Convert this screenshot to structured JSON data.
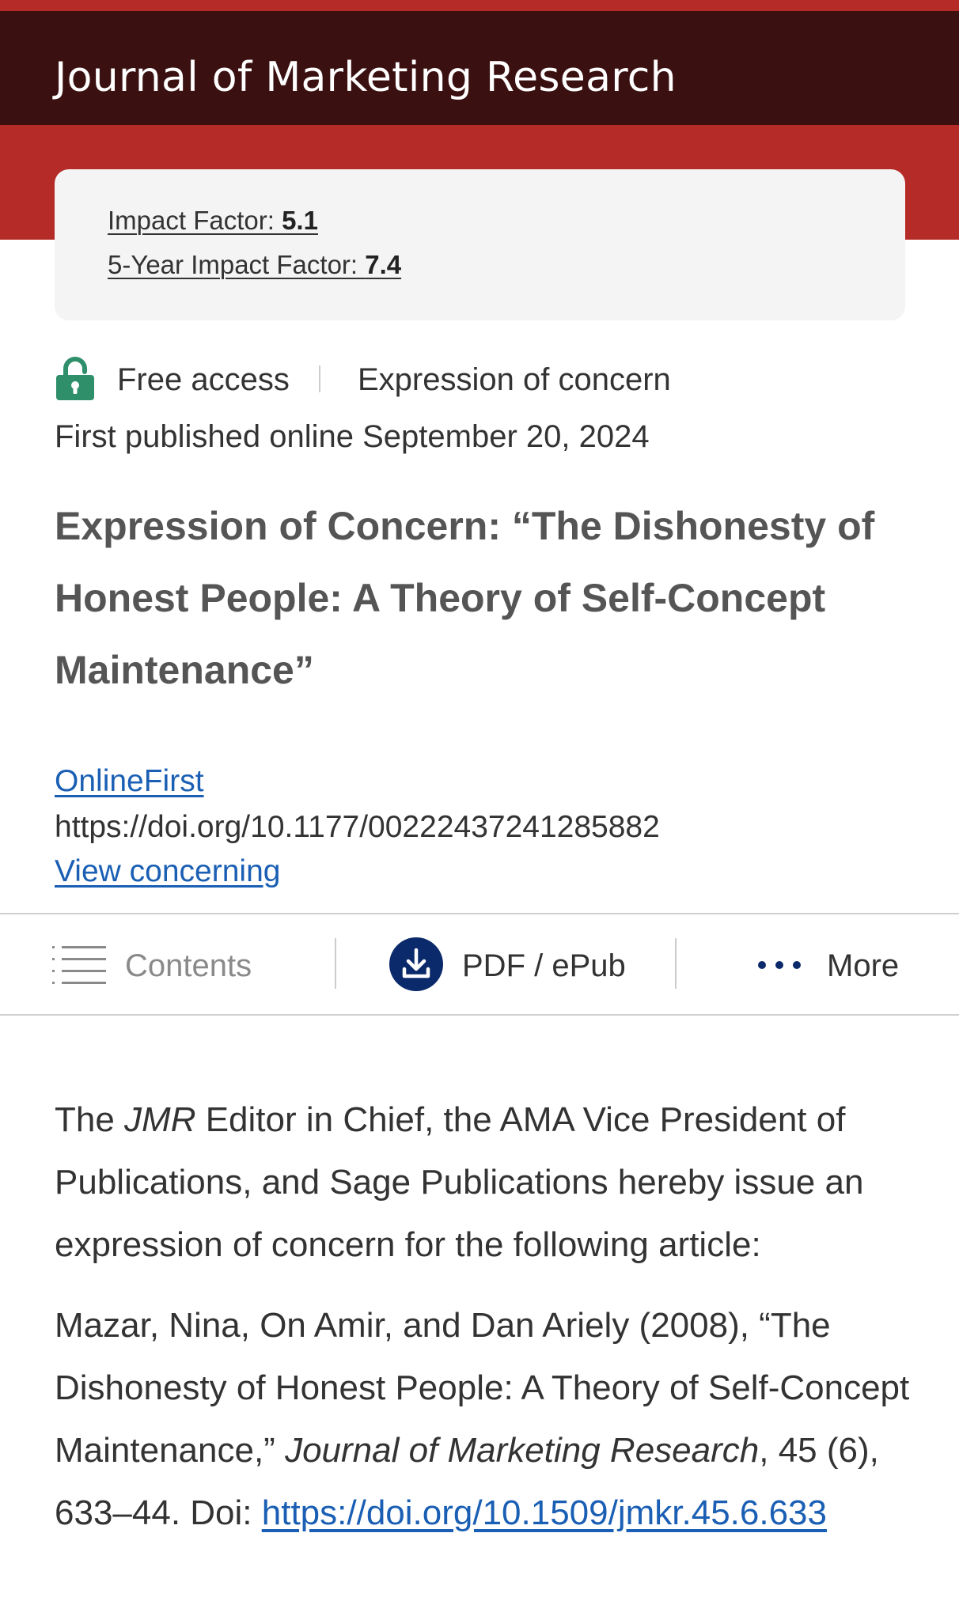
{
  "header": {
    "journal_title": "Journal of Marketing Research"
  },
  "impact": {
    "impact_factor_label": "Impact Factor: ",
    "impact_factor_value": "5.1",
    "five_year_label": "5-Year Impact Factor: ",
    "five_year_value": "7.4"
  },
  "access": {
    "lock_icon": "lock-open-icon",
    "free_access": "Free access",
    "article_type": "Expression of concern"
  },
  "published": "First published online September 20, 2024",
  "article_title": "Expression of Concern: “The Dishonesty of Honest People: A Theory of Self-Concept Maintenance”",
  "links": {
    "onlinefirst": "OnlineFirst",
    "doi": "https://doi.org/10.1177/00222437241285882",
    "view_concerning": "View concerning"
  },
  "toolbar": {
    "contents_icon": "list-icon",
    "contents_label": "Contents",
    "pdf_icon": "download-icon",
    "pdf_label": "PDF / ePub",
    "more_icon": "more-dots-icon",
    "more_label": "More"
  },
  "body": {
    "p1_the": "The ",
    "p1_jmr": "JMR",
    "p1_rest": " Editor in Chief, the AMA Vice President of Publications, and Sage Publications hereby issue an expression of concern for the following article:",
    "p2_citation": "Mazar, Nina, On Amir, and Dan Ariely (2008), “The Dishonesty of Honest People: A Theory of Self-Concept Maintenance,” ",
    "p2_journal": "Journal of Marketing Research",
    "p2_volume": ", 45 (6), 633–44. Doi: ",
    "p2_doi": "https://doi.org/10.1509/jmkr.45.6.633"
  },
  "colors": {
    "header_dark": "#3a1110",
    "brand_red": "#b42b27",
    "link_blue": "#1a5fb4",
    "lock_green": "#2f8f6b",
    "download_navy": "#0b2a6b"
  }
}
